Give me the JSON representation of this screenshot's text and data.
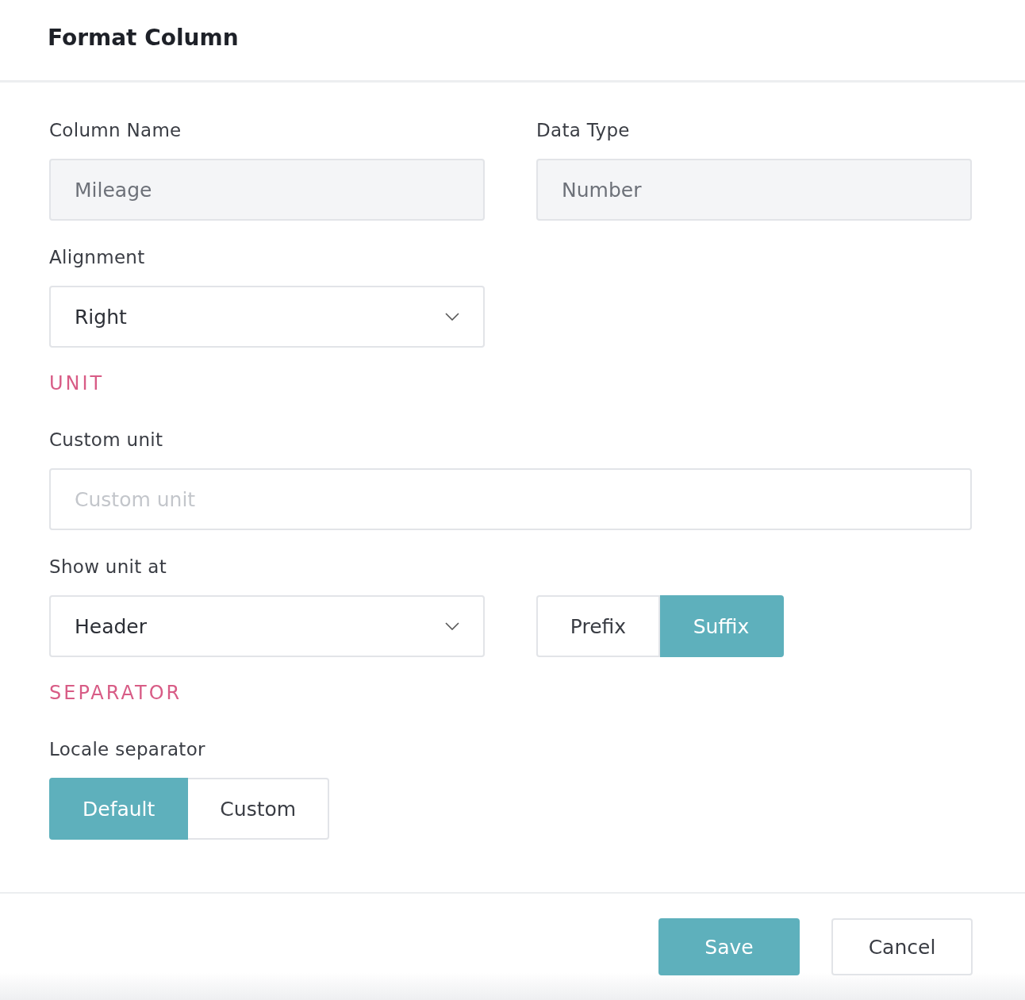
{
  "dialog": {
    "title": "Format Column"
  },
  "sections": [
    {
      "kind": "row",
      "fields": [
        {
          "kind": "text",
          "label": "Column Name",
          "value": "Mileage",
          "disabled": true
        },
        {
          "kind": "text",
          "label": "Data Type",
          "value": "Number",
          "disabled": true
        }
      ]
    },
    {
      "kind": "row",
      "fields": [
        {
          "kind": "select",
          "label": "Alignment",
          "value": "Right"
        }
      ]
    },
    {
      "kind": "heading",
      "text": "UNIT"
    },
    {
      "kind": "row",
      "fields": [
        {
          "kind": "input",
          "label": "Custom unit",
          "placeholder": "Custom unit"
        }
      ]
    },
    {
      "kind": "row",
      "fields": [
        {
          "kind": "select",
          "label": "Show unit at",
          "value": "Header"
        },
        {
          "kind": "toggle",
          "options": [
            {
              "label": "Prefix",
              "selected": false
            },
            {
              "label": "Suffix",
              "selected": true
            }
          ]
        }
      ]
    },
    {
      "kind": "heading",
      "text": "SEPARATOR"
    },
    {
      "kind": "row",
      "fields": [
        {
          "kind": "toggle",
          "label": "Locale separator",
          "options": [
            {
              "label": "Default",
              "selected": true
            },
            {
              "label": "Custom",
              "selected": false
            }
          ]
        }
      ]
    }
  ],
  "buttons": [
    {
      "label": "Save",
      "kind": "primary"
    },
    {
      "label": "Cancel",
      "kind": "secondary"
    }
  ]
}
